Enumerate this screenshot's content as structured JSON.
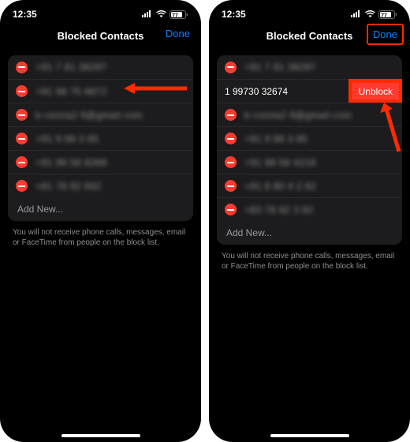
{
  "status": {
    "time": "12:35",
    "battery": "77"
  },
  "left": {
    "title": "Blocked Contacts",
    "done": "Done",
    "rows": [
      "+91 7 81 38297",
      "+91 98 75 8872",
      "b conna2 9@gmail.com",
      "+91 9 88 3 85",
      "+91 98 58 8268",
      "+81 78 92 842"
    ],
    "add_new": "Add New...",
    "footnote": "You will not receive phone calls, messages, email or FaceTime from people on the block list."
  },
  "right": {
    "title": "Blocked Contacts",
    "done": "Done",
    "revealed_label": "1 99730 32674",
    "unblock": "Unblock",
    "rows": [
      "+91 7 81 38297",
      "b conna2 9@gmail.com",
      "+91 9 88 3 85",
      "+91 98 58 4218",
      "+91 8 80 4 2 82",
      "+83 78 82 3 82"
    ],
    "add_new": "Add New...",
    "footnote": "You will not receive phone calls, messages, email or FaceTime from people on the block list."
  }
}
